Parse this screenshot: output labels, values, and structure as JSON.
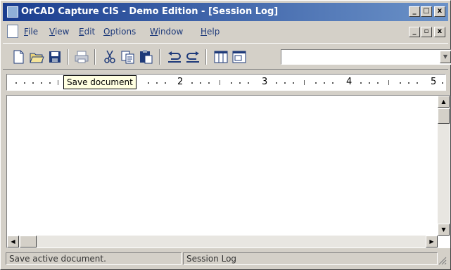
{
  "window": {
    "title": "OrCAD Capture CIS - Demo Edition - [Session Log]",
    "icon": "orcad-app-icon"
  },
  "title_buttons": {
    "minimize": "_",
    "maximize": "□",
    "close": "x"
  },
  "menu": {
    "items": [
      {
        "hotkey": "F",
        "rest": "ile"
      },
      {
        "hotkey": "V",
        "rest": "iew"
      },
      {
        "hotkey": "E",
        "rest": "dit"
      },
      {
        "hotkey": "O",
        "rest": "ptions"
      },
      {
        "hotkey": "W",
        "rest": "indow"
      },
      {
        "hotkey": "H",
        "rest": "elp"
      }
    ]
  },
  "mdi_buttons": {
    "minimize": "_",
    "restore": "▫",
    "close": "x"
  },
  "toolbar": {
    "buttons": [
      "new-document-icon",
      "open-folder-icon",
      "save-disk-icon",
      "print-icon",
      "cut-icon",
      "copy-icon",
      "paste-icon",
      "undo-icon",
      "redo-icon",
      "columns-icon",
      "window-icon"
    ],
    "combo_value": "",
    "combo_arrow": "▼"
  },
  "ruler": {
    "labels": [
      "2",
      "3",
      "4",
      "5"
    ]
  },
  "tooltip": {
    "text": "Save document"
  },
  "scroll": {
    "up": "▲",
    "down": "▼",
    "left": "◀",
    "right": "▶"
  },
  "status": {
    "message": "Save active document.",
    "pane": "Session Log"
  },
  "colors": {
    "titlebar_start": "#1a3d8f",
    "titlebar_end": "#6b92c8",
    "menu_text": "#1e3a7a",
    "chrome": "#d4d0c8",
    "tooltip_bg": "#ffffe1"
  }
}
